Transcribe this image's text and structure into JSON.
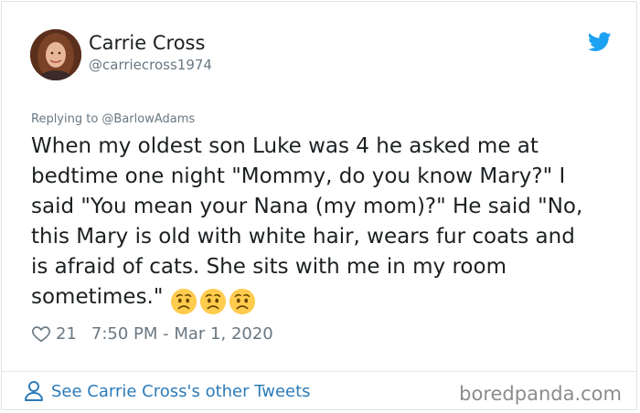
{
  "tweet": {
    "author_name": "Carrie Cross",
    "author_handle": "@carriecross1974",
    "replying_to": "Replying to @BarlowAdams",
    "text_lines": [
      "When my oldest son Luke was 4 he asked me at",
      "bedtime one night \"Mommy, do you know Mary?\" I",
      "said \"You mean your Nana (my mom)?\" He said \"No,",
      "this Mary is old with white hair, wears fur coats and",
      "is afraid of cats. She sits with me in my room",
      "sometimes.\""
    ],
    "emoji_name": "worried-face-icon",
    "emoji_count": 3,
    "like_count": "21",
    "timestamp": "7:50 PM - Mar 1, 2020"
  },
  "footer": {
    "link_label": "See Carrie Cross's other Tweets",
    "watermark": "boredpanda.com"
  },
  "colors": {
    "text": "#1c2022",
    "secondary": "#697882",
    "link": "#2b7bb9",
    "twitter_blue": "#1da1f2",
    "border": "#e1e8ed"
  }
}
